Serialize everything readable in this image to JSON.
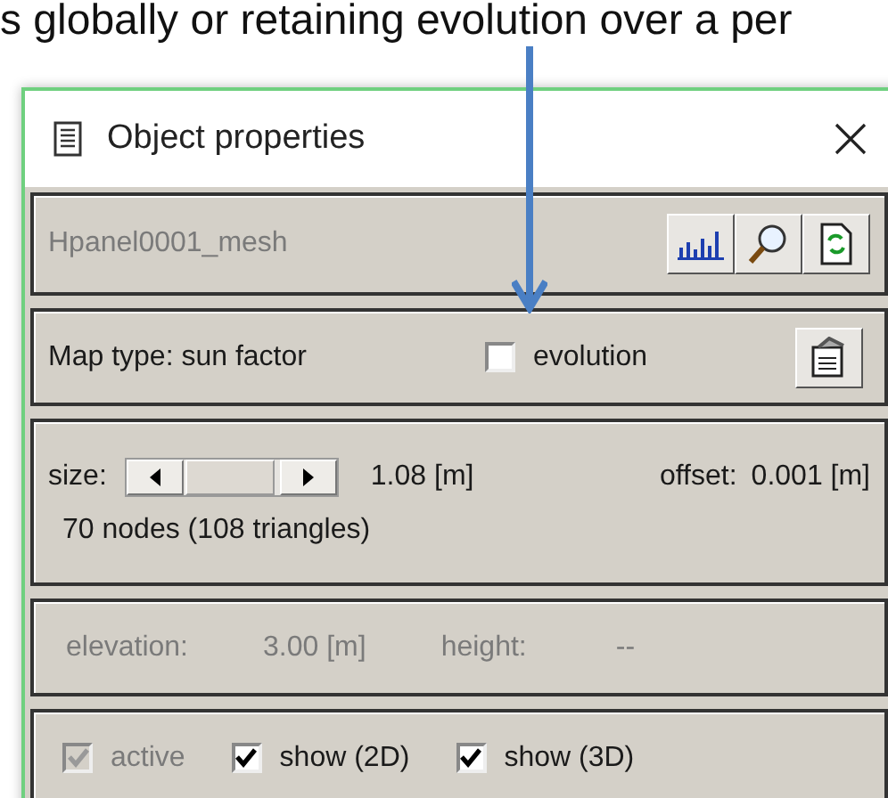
{
  "document_text": "s globally or retaining evolution over a per",
  "window": {
    "title": "Object properties"
  },
  "object_name": {
    "value": "Hpanel0001_mesh",
    "disabled": true
  },
  "map_panel": {
    "map_type": "Map type: sun factor",
    "evolution": {
      "label": "evolution",
      "checked": false
    }
  },
  "size_panel": {
    "size_label": "size:",
    "size_value": "1.08 [m]",
    "offset_label": "offset:",
    "offset_value": "0.001 [m]",
    "mesh_info": "70 nodes (108 triangles)"
  },
  "position_panel": {
    "disabled": true,
    "elevation_label": "elevation:",
    "elevation_value": "3.00 [m]",
    "height_label": "height:",
    "height_value": "--"
  },
  "checkboxes": [
    {
      "label": "active",
      "checked": true,
      "disabled": true
    },
    {
      "label": "show (2D)",
      "checked": true,
      "disabled": false
    },
    {
      "label": "show (3D)",
      "checked": true,
      "disabled": false
    }
  ]
}
